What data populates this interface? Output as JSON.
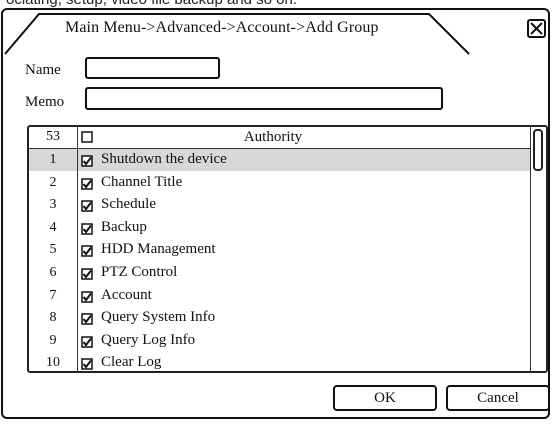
{
  "window": {
    "top_cut_text": "ociating, setup, video file backup and so on.",
    "title": "Main Menu->Advanced->Account->Add Group",
    "close_icon": "close-x-icon"
  },
  "form": {
    "name_label": "Name",
    "name_value": "",
    "memo_label": "Memo",
    "memo_value": ""
  },
  "authority_list": {
    "header_count": "53",
    "header_label": "Authority",
    "header_checked": false,
    "selected_index": 0,
    "rows": [
      {
        "num": "1",
        "label": "Shutdown the device",
        "checked": true
      },
      {
        "num": "2",
        "label": "Channel Title",
        "checked": true
      },
      {
        "num": "3",
        "label": "Schedule",
        "checked": true
      },
      {
        "num": "4",
        "label": "Backup",
        "checked": true
      },
      {
        "num": "5",
        "label": "HDD Management",
        "checked": true
      },
      {
        "num": "6",
        "label": "PTZ Control",
        "checked": true
      },
      {
        "num": "7",
        "label": "Account",
        "checked": true
      },
      {
        "num": "8",
        "label": "Query System Info",
        "checked": true
      },
      {
        "num": "9",
        "label": "Query Log Info",
        "checked": true
      },
      {
        "num": "10",
        "label": "Clear Log",
        "checked": true
      }
    ]
  },
  "buttons": {
    "ok_label": "OK",
    "cancel_label": "Cancel"
  }
}
